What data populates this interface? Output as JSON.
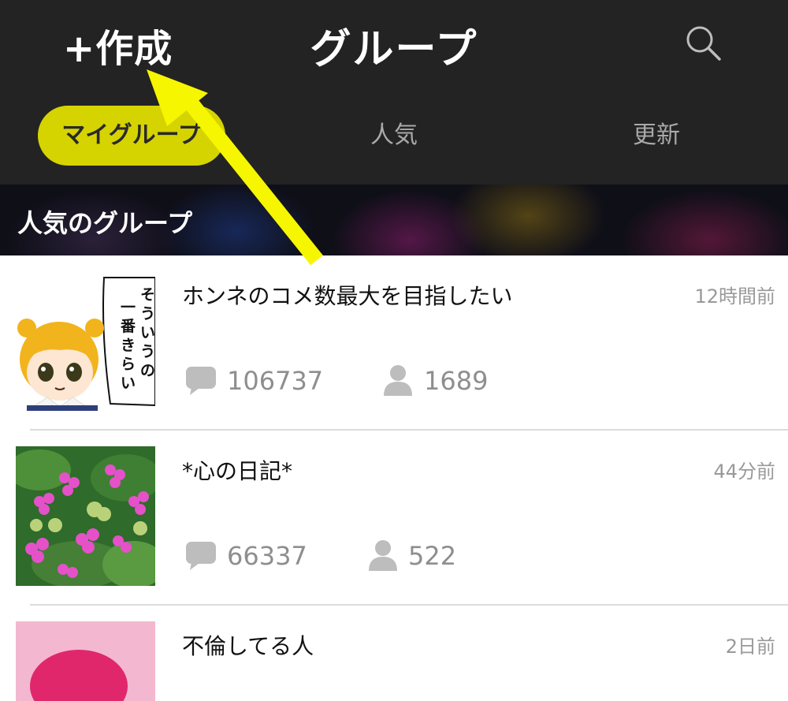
{
  "header": {
    "create_label": "+作成",
    "title": "グループ",
    "search_icon": "search-icon"
  },
  "tabs": [
    {
      "label": "マイグループ",
      "active": true
    },
    {
      "label": "人気",
      "active": false
    },
    {
      "label": "更新",
      "active": false
    }
  ],
  "section": {
    "label": "人気のグループ"
  },
  "groups": [
    {
      "title": "ホンネのコメ数最大を目指したい",
      "time": "12時間前",
      "comments": "106737",
      "members": "1689",
      "thumb_caption": "そういうの一番きらい"
    },
    {
      "title": "*心の日記*",
      "time": "44分前",
      "comments": "66337",
      "members": "522"
    },
    {
      "title": "不倫してる人",
      "time": "2日前"
    }
  ],
  "colors": {
    "accent": "#d6d400",
    "header_bg": "#232323",
    "annotation_arrow": "#f6f600"
  }
}
